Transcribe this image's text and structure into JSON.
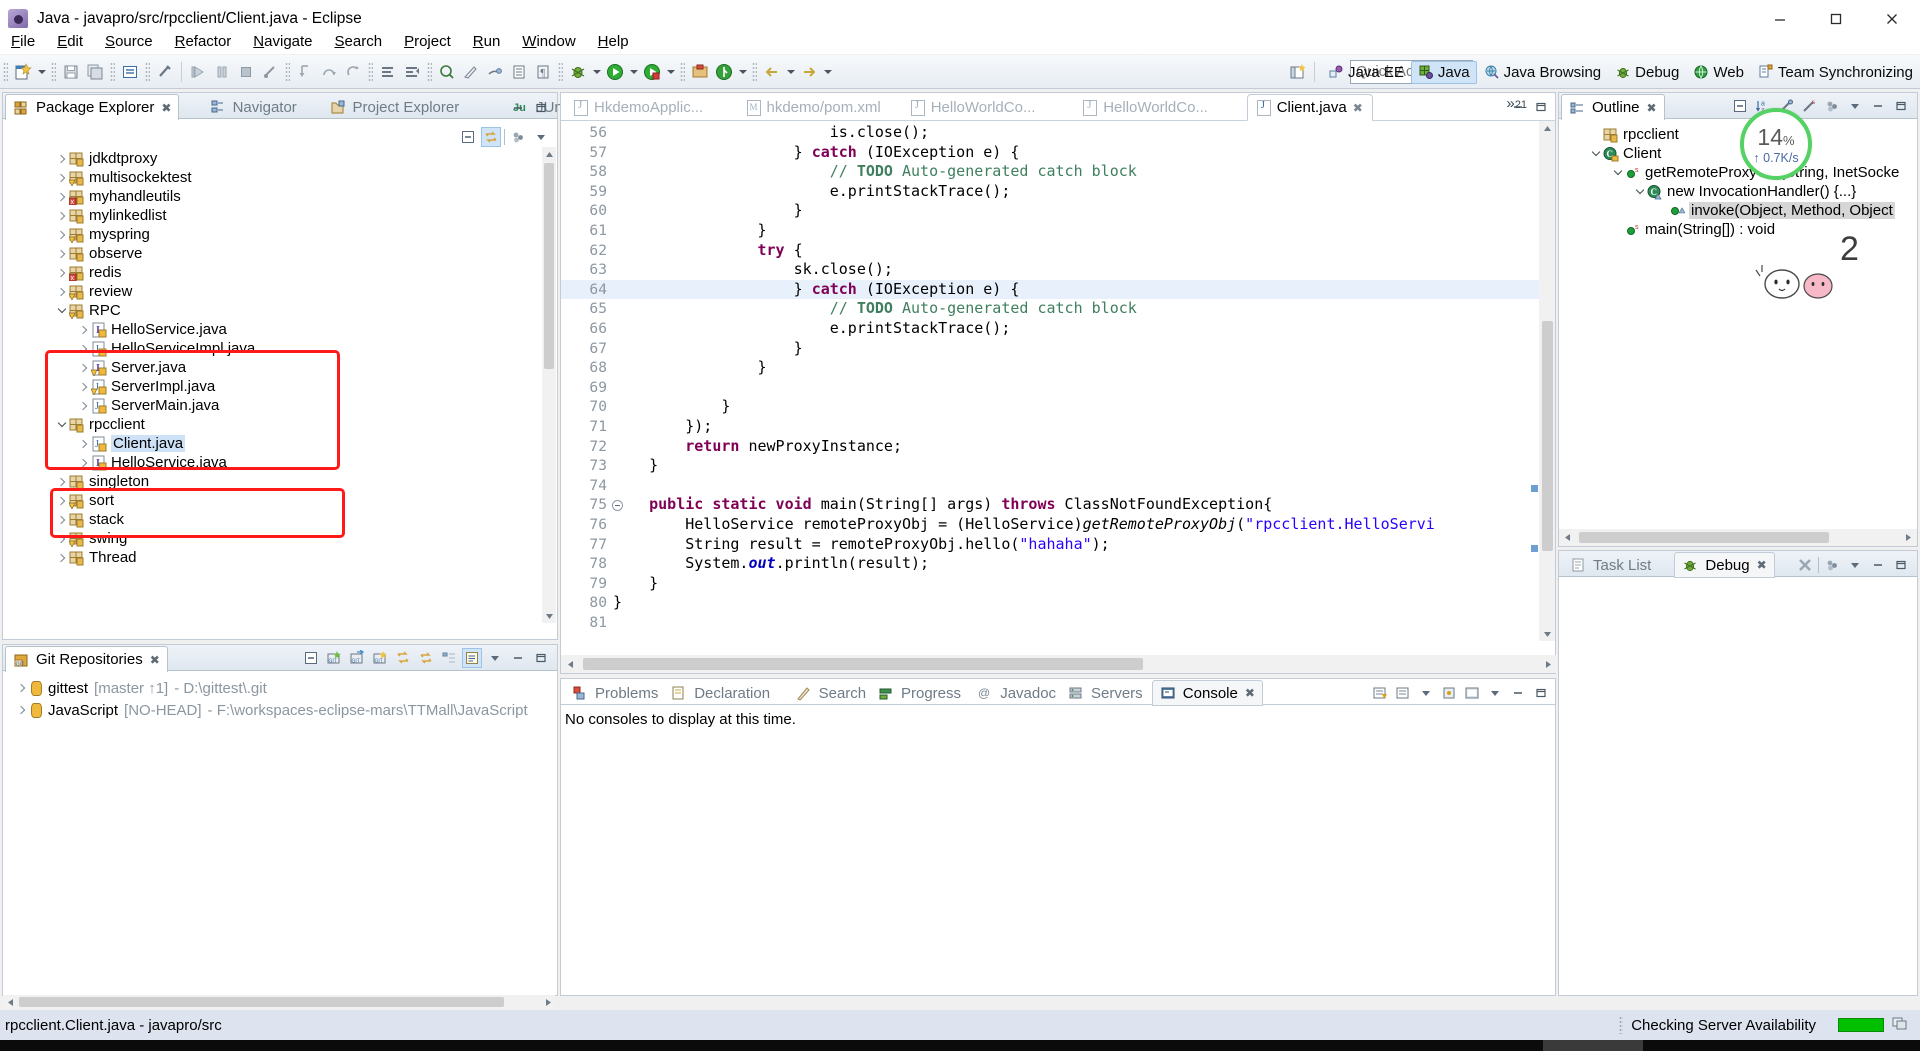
{
  "window": {
    "title": "Java - javapro/src/rpcclient/Client.java - Eclipse",
    "app_icon": "eclipse-icon",
    "minimize": "minimize-button",
    "maximize": "maximize-button",
    "close": "close-button"
  },
  "menubar": [
    "File",
    "Edit",
    "Source",
    "Refactor",
    "Navigate",
    "Search",
    "Project",
    "Run",
    "Window",
    "Help"
  ],
  "toolbar": {
    "quick_access_placeholder": "Quick Access",
    "buttons": [
      "new-wizard-icon",
      "save-icon",
      "save-all-icon",
      "print-icon",
      "toggle-comment-icon",
      "run-debug-icon",
      "resume-icon",
      "suspend-icon",
      "terminate-icon",
      "disconnect-icon",
      "step-into-icon",
      "step-over-icon",
      "step-return-icon",
      "new-java-class-icon",
      "new-java-package-icon",
      "open-type-icon",
      "search-icon",
      "toggle-breadcrumb-icon",
      "toggle-mark-occurrences-icon",
      "debug-icon",
      "run-icon",
      "run-external-tools-icon",
      "coverage-icon",
      "git-icon",
      "next-annotation-icon",
      "previous-annotation-icon",
      "back-icon",
      "forward-icon"
    ]
  },
  "perspectives": {
    "open_perspective": "open-perspective-icon",
    "items": [
      {
        "label": "Java EE",
        "icon": "java-ee-icon",
        "active": false
      },
      {
        "label": "Java",
        "icon": "java-icon",
        "active": true
      },
      {
        "label": "Java Browsing",
        "icon": "java-browsing-icon",
        "active": false
      },
      {
        "label": "Debug",
        "icon": "debug-icon",
        "active": false
      },
      {
        "label": "Web",
        "icon": "web-icon",
        "active": false
      },
      {
        "label": "Team Synchronizing",
        "icon": "team-sync-icon",
        "active": false
      }
    ]
  },
  "package_explorer": {
    "tabs": [
      {
        "label": "Package Explorer",
        "icon": "package-explorer-icon",
        "active": true,
        "close": "✖"
      },
      {
        "label": "Navigator",
        "icon": "navigator-icon",
        "active": false
      },
      {
        "label": "Project Explorer",
        "icon": "project-explorer-icon",
        "active": false
      },
      {
        "label": "JUnit",
        "icon": "junit-icon",
        "active": false
      }
    ],
    "view_buttons": [
      "collapse-all-icon",
      "link-with-editor-icon",
      "view-menu-icon",
      "minimize-icon",
      "maximize-icon"
    ],
    "tree": [
      {
        "label": "jdkdtproxy",
        "indent": 1,
        "twisty": "r",
        "icon": "package-icon",
        "selected": false
      },
      {
        "label": "multisockektest",
        "indent": 1,
        "twisty": "r",
        "icon": "package-warn-icon",
        "selected": false
      },
      {
        "label": "myhandleutils",
        "indent": 1,
        "twisty": "r",
        "icon": "package-error-icon",
        "selected": false
      },
      {
        "label": "mylinkedlist",
        "indent": 1,
        "twisty": "r",
        "icon": "package-icon",
        "selected": false
      },
      {
        "label": "myspring",
        "indent": 1,
        "twisty": "r",
        "icon": "package-warn-icon",
        "selected": false
      },
      {
        "label": "observe",
        "indent": 1,
        "twisty": "r",
        "icon": "package-icon",
        "selected": false
      },
      {
        "label": "redis",
        "indent": 1,
        "twisty": "r",
        "icon": "package-error-icon",
        "selected": false
      },
      {
        "label": "review",
        "indent": 1,
        "twisty": "r",
        "icon": "package-warn-icon",
        "selected": false
      },
      {
        "label": "RPC",
        "indent": 1,
        "twisty": "d",
        "icon": "package-warn-icon",
        "selected": false
      },
      {
        "label": "HelloService.java",
        "indent": 2,
        "twisty": "r",
        "icon": "java-interface-icon",
        "selected": false
      },
      {
        "label": "HelloServiceImpl.java",
        "indent": 2,
        "twisty": "r",
        "icon": "java-class-icon",
        "selected": false
      },
      {
        "label": "Server.java",
        "indent": 2,
        "twisty": "r",
        "icon": "java-interface-warn-icon",
        "selected": false
      },
      {
        "label": "ServerImpl.java",
        "indent": 2,
        "twisty": "r",
        "icon": "java-class-warn-icon",
        "selected": false
      },
      {
        "label": "ServerMain.java",
        "indent": 2,
        "twisty": "r",
        "icon": "java-class-icon",
        "selected": false
      },
      {
        "label": "rpcclient",
        "indent": 1,
        "twisty": "d",
        "icon": "package-icon",
        "selected": false
      },
      {
        "label": "Client.java",
        "indent": 2,
        "twisty": "r",
        "icon": "java-class-icon",
        "selected": true
      },
      {
        "label": "HelloService.java",
        "indent": 2,
        "twisty": "r",
        "icon": "java-interface-icon",
        "selected": false
      },
      {
        "label": "singleton",
        "indent": 1,
        "twisty": "r",
        "icon": "package-icon",
        "selected": false
      },
      {
        "label": "sort",
        "indent": 1,
        "twisty": "r",
        "icon": "package-warn-icon",
        "selected": false
      },
      {
        "label": "stack",
        "indent": 1,
        "twisty": "r",
        "icon": "package-icon",
        "selected": false
      },
      {
        "label": "swing",
        "indent": 1,
        "twisty": "r",
        "icon": "package-warn-icon",
        "selected": false
      },
      {
        "label": "Thread",
        "indent": 1,
        "twisty": "r",
        "icon": "package-icon",
        "selected": false
      }
    ]
  },
  "git_repositories": {
    "tab": {
      "label": "Git Repositories",
      "icon": "git-repositories-icon",
      "close": "✖"
    },
    "view_buttons": [
      "collapse-all-icon",
      "add-repository-icon",
      "clone-repository-icon",
      "create-repository-icon",
      "pull-icon",
      "link-with-selection-icon",
      "hierarchy-icon",
      "toggle-branch-icon",
      "view-menu-icon",
      "minimize-icon",
      "maximize-icon"
    ],
    "rows": [
      {
        "name": "gittest",
        "branch": "[master ↑1]",
        "path": "- D:\\gittest\\.git"
      },
      {
        "name": "JavaScript",
        "branch": "[NO-HEAD]",
        "path": "- F:\\workspaces-eclipse-mars\\TTMall\\JavaScript"
      }
    ]
  },
  "editor": {
    "tabs": [
      {
        "label": "HkdemoApplic...",
        "icon": "java-file-icon",
        "active": false
      },
      {
        "label": "hkdemo/pom.xml",
        "icon": "maven-file-icon",
        "active": false
      },
      {
        "label": "HelloWorldCo...",
        "icon": "java-file-icon",
        "active": false
      },
      {
        "label": "HelloWorldCo...",
        "icon": "java-file-icon",
        "active": false
      },
      {
        "label": "Client.java",
        "icon": "java-file-icon",
        "active": true,
        "close": "✖"
      }
    ],
    "overflow_indicator": "»",
    "overflow_count": "21",
    "highlight_line": 64,
    "first_line": 56,
    "lines": [
      {
        "n": 56,
        "folding": "",
        "breakpoint": "",
        "tokens": [
          {
            "t": "                        is.close();",
            "c": "pln"
          }
        ]
      },
      {
        "n": 57,
        "folding": "",
        "breakpoint": "",
        "tokens": [
          {
            "t": "                    } ",
            "c": "pln"
          },
          {
            "t": "catch",
            "c": "kw"
          },
          {
            "t": " (IOException e) {",
            "c": "pln"
          }
        ]
      },
      {
        "n": 58,
        "folding": "",
        "breakpoint": "todo",
        "tokens": [
          {
            "t": "                        ",
            "c": "pln"
          },
          {
            "t": "// ",
            "c": "cmt"
          },
          {
            "t": "TODO",
            "c": "todo"
          },
          {
            "t": " Auto-generated catch block",
            "c": "cmt"
          }
        ]
      },
      {
        "n": 59,
        "folding": "",
        "breakpoint": "",
        "tokens": [
          {
            "t": "                        e.printStackTrace();",
            "c": "pln"
          }
        ]
      },
      {
        "n": 60,
        "folding": "",
        "breakpoint": "",
        "tokens": [
          {
            "t": "                    }",
            "c": "pln"
          }
        ]
      },
      {
        "n": 61,
        "folding": "",
        "breakpoint": "",
        "tokens": [
          {
            "t": "                }",
            "c": "pln"
          }
        ]
      },
      {
        "n": 62,
        "folding": "",
        "breakpoint": "",
        "tokens": [
          {
            "t": "                ",
            "c": "pln"
          },
          {
            "t": "try",
            "c": "kw"
          },
          {
            "t": " {",
            "c": "pln"
          }
        ]
      },
      {
        "n": 63,
        "folding": "",
        "breakpoint": "",
        "tokens": [
          {
            "t": "                    sk.close();",
            "c": "pln"
          }
        ]
      },
      {
        "n": 64,
        "folding": "",
        "breakpoint": "",
        "tokens": [
          {
            "t": "                    } ",
            "c": "pln"
          },
          {
            "t": "catch",
            "c": "kw"
          },
          {
            "t": " (IOException e) {",
            "c": "pln"
          }
        ]
      },
      {
        "n": 65,
        "folding": "",
        "breakpoint": "todo",
        "tokens": [
          {
            "t": "                        ",
            "c": "pln"
          },
          {
            "t": "// ",
            "c": "cmt"
          },
          {
            "t": "TODO",
            "c": "todo"
          },
          {
            "t": " Auto-generated catch block",
            "c": "cmt"
          }
        ]
      },
      {
        "n": 66,
        "folding": "",
        "breakpoint": "",
        "tokens": [
          {
            "t": "                        e.printStackTrace();",
            "c": "pln"
          }
        ]
      },
      {
        "n": 67,
        "folding": "",
        "breakpoint": "",
        "tokens": [
          {
            "t": "                    }",
            "c": "pln"
          }
        ]
      },
      {
        "n": 68,
        "folding": "",
        "breakpoint": "",
        "tokens": [
          {
            "t": "                }",
            "c": "pln"
          }
        ]
      },
      {
        "n": 69,
        "folding": "",
        "breakpoint": "",
        "tokens": [
          {
            "t": "",
            "c": "pln"
          }
        ]
      },
      {
        "n": 70,
        "folding": "",
        "breakpoint": "",
        "tokens": [
          {
            "t": "            }",
            "c": "pln"
          }
        ]
      },
      {
        "n": 71,
        "folding": "",
        "breakpoint": "",
        "tokens": [
          {
            "t": "        });",
            "c": "pln"
          }
        ]
      },
      {
        "n": 72,
        "folding": "",
        "breakpoint": "",
        "tokens": [
          {
            "t": "        ",
            "c": "pln"
          },
          {
            "t": "return",
            "c": "kw"
          },
          {
            "t": " newProxyInstance;",
            "c": "pln"
          }
        ]
      },
      {
        "n": 73,
        "folding": "",
        "breakpoint": "",
        "tokens": [
          {
            "t": "    }",
            "c": "pln"
          }
        ]
      },
      {
        "n": 74,
        "folding": "",
        "breakpoint": "",
        "tokens": [
          {
            "t": "",
            "c": "pln"
          }
        ]
      },
      {
        "n": 75,
        "folding": "collapse",
        "breakpoint": "",
        "tokens": [
          {
            "t": "    ",
            "c": "pln"
          },
          {
            "t": "public static void",
            "c": "kw"
          },
          {
            "t": " main(String[] args) ",
            "c": "pln"
          },
          {
            "t": "throws",
            "c": "kw"
          },
          {
            "t": " ClassNotFoundException{",
            "c": "pln"
          }
        ]
      },
      {
        "n": 76,
        "folding": "",
        "breakpoint": "",
        "tokens": [
          {
            "t": "        HelloService remoteProxyObj = (HelloService)",
            "c": "pln"
          },
          {
            "t": "getRemoteProxyObj",
            "c": "mth"
          },
          {
            "t": "(",
            "c": "pln"
          },
          {
            "t": "\"rpcclient.HelloServi",
            "c": "str"
          }
        ]
      },
      {
        "n": 77,
        "folding": "",
        "breakpoint": "",
        "tokens": [
          {
            "t": "        String result = remoteProxyObj.hello(",
            "c": "pln"
          },
          {
            "t": "\"hahaha\"",
            "c": "str"
          },
          {
            "t": ");",
            "c": "pln"
          }
        ]
      },
      {
        "n": 78,
        "folding": "",
        "breakpoint": "",
        "tokens": [
          {
            "t": "        System.",
            "c": "pln"
          },
          {
            "t": "out",
            "c": "fld"
          },
          {
            "t": ".println(result);",
            "c": "pln"
          }
        ]
      },
      {
        "n": 79,
        "folding": "",
        "breakpoint": "",
        "tokens": [
          {
            "t": "    }",
            "c": "pln"
          }
        ]
      },
      {
        "n": 80,
        "folding": "",
        "breakpoint": "",
        "tokens": [
          {
            "t": "}",
            "c": "pln"
          }
        ]
      },
      {
        "n": 81,
        "folding": "",
        "breakpoint": "",
        "tokens": [
          {
            "t": "",
            "c": "pln"
          }
        ]
      }
    ]
  },
  "outline": {
    "tab": {
      "label": "Outline",
      "icon": "outline-icon",
      "close": "✖"
    },
    "view_buttons": [
      "collapse-all-icon",
      "sort-icon",
      "hide-fields-icon",
      "hide-static-icon",
      "hide-nonpublic-icon",
      "view-menu-icon",
      "minimize-icon",
      "maximize-icon"
    ],
    "tree": [
      {
        "label": "rpcclient",
        "indent": 1,
        "twisty": "",
        "icon": "package-icon",
        "selected": false
      },
      {
        "label": "Client",
        "indent": 1,
        "twisty": "d",
        "icon": "class-icon",
        "selected": false
      },
      {
        "label": "getRemoteProxyObj(String, InetSocke",
        "indent": 2,
        "twisty": "d",
        "icon": "method-static-icon",
        "selected": false
      },
      {
        "label": "new InvocationHandler() {...}",
        "indent": 3,
        "twisty": "d",
        "icon": "anonymous-class-icon",
        "selected": false
      },
      {
        "label": "invoke(Object, Method, Object",
        "indent": 4,
        "twisty": "",
        "icon": "method-icon",
        "selected": true
      },
      {
        "label": "main(String[]) : void",
        "indent": 2,
        "twisty": "",
        "icon": "method-static-icon",
        "selected": false
      }
    ]
  },
  "debug_panel": {
    "tabs": [
      {
        "label": "Task List",
        "icon": "task-list-icon",
        "active": false
      },
      {
        "label": "Debug",
        "icon": "debug-icon",
        "active": true,
        "close": "✖"
      }
    ],
    "view_buttons": [
      "remove-all-terminated-icon",
      "view-menu-icon",
      "minimize-icon",
      "maximize-icon"
    ]
  },
  "bottom_panel": {
    "tabs": [
      {
        "label": "Problems",
        "icon": "problems-icon",
        "active": false
      },
      {
        "label": "Declaration",
        "icon": "declaration-icon",
        "active": false
      },
      {
        "label": "Search",
        "icon": "search-icon",
        "active": false
      },
      {
        "label": "Progress",
        "icon": "progress-icon",
        "active": false
      },
      {
        "label": "Javadoc",
        "icon": "javadoc-icon",
        "active": false
      },
      {
        "label": "Servers",
        "icon": "servers-icon",
        "active": false
      },
      {
        "label": "Console",
        "icon": "console-icon",
        "active": true,
        "close": "✖"
      }
    ],
    "view_buttons": [
      "clear-console-icon",
      "scroll-lock-icon",
      "pin-console-icon",
      "display-console-icon",
      "open-console-icon",
      "minimize-icon",
      "maximize-icon"
    ],
    "content": "No consoles to display at this time."
  },
  "statusbar": {
    "left": "rpcclient.Client.java - javapro/src",
    "right": "Checking Server Availability",
    "progress_color": "#00c000",
    "progress_icon": "progress-windows-icon"
  },
  "overlays": {
    "network_widget": {
      "percent": "14",
      "percent_unit": "%",
      "rate": "↑ 0.7K/s",
      "ring_color": "#54d264"
    },
    "watermark_number": "2",
    "annotation_boxes": [
      "rpc-package-files-highlight",
      "rpcclient-package-files-highlight"
    ],
    "annotation_color": "#ff1a1a"
  }
}
